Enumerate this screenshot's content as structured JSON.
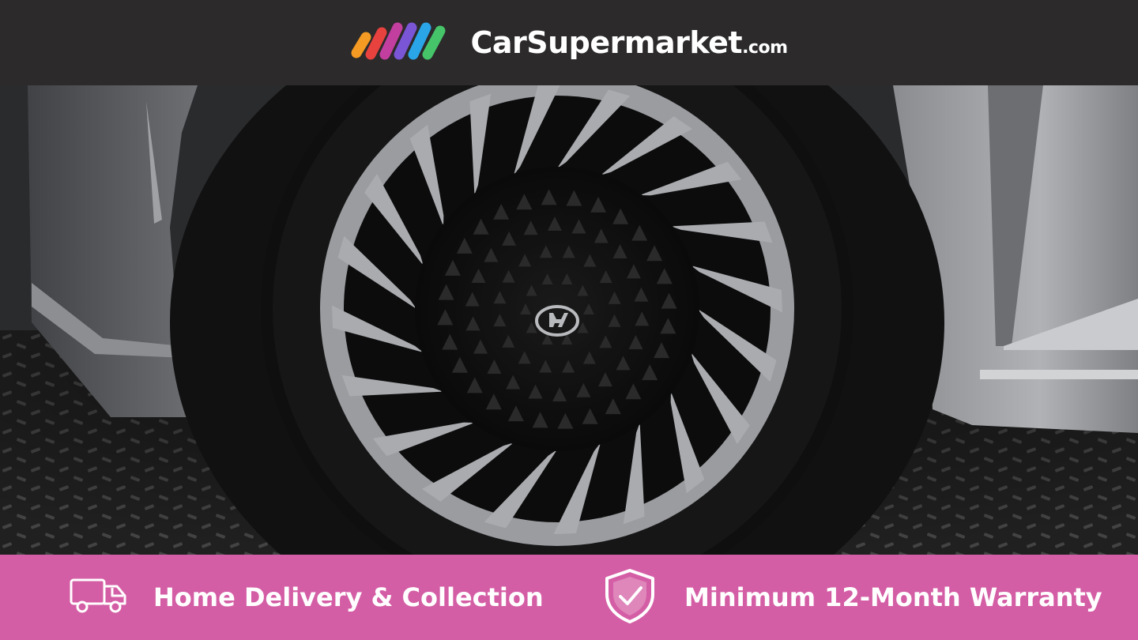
{
  "header": {
    "brand_name": "CarSupermarket",
    "brand_tld": ".com",
    "logo_icon": "rainbow-stripes-icon"
  },
  "photo": {
    "subject": "car-wheel-photo",
    "badge_icon": "hyundai-badge-icon"
  },
  "footer": {
    "features": [
      {
        "icon": "delivery-truck-icon",
        "label": "Home Delivery & Collection"
      },
      {
        "icon": "shield-check-icon",
        "label": "Minimum 12-Month Warranty"
      }
    ]
  },
  "colors": {
    "header_bg": "#2c2a2a",
    "footer_bg": "#d45ea5",
    "text": "#ffffff"
  }
}
